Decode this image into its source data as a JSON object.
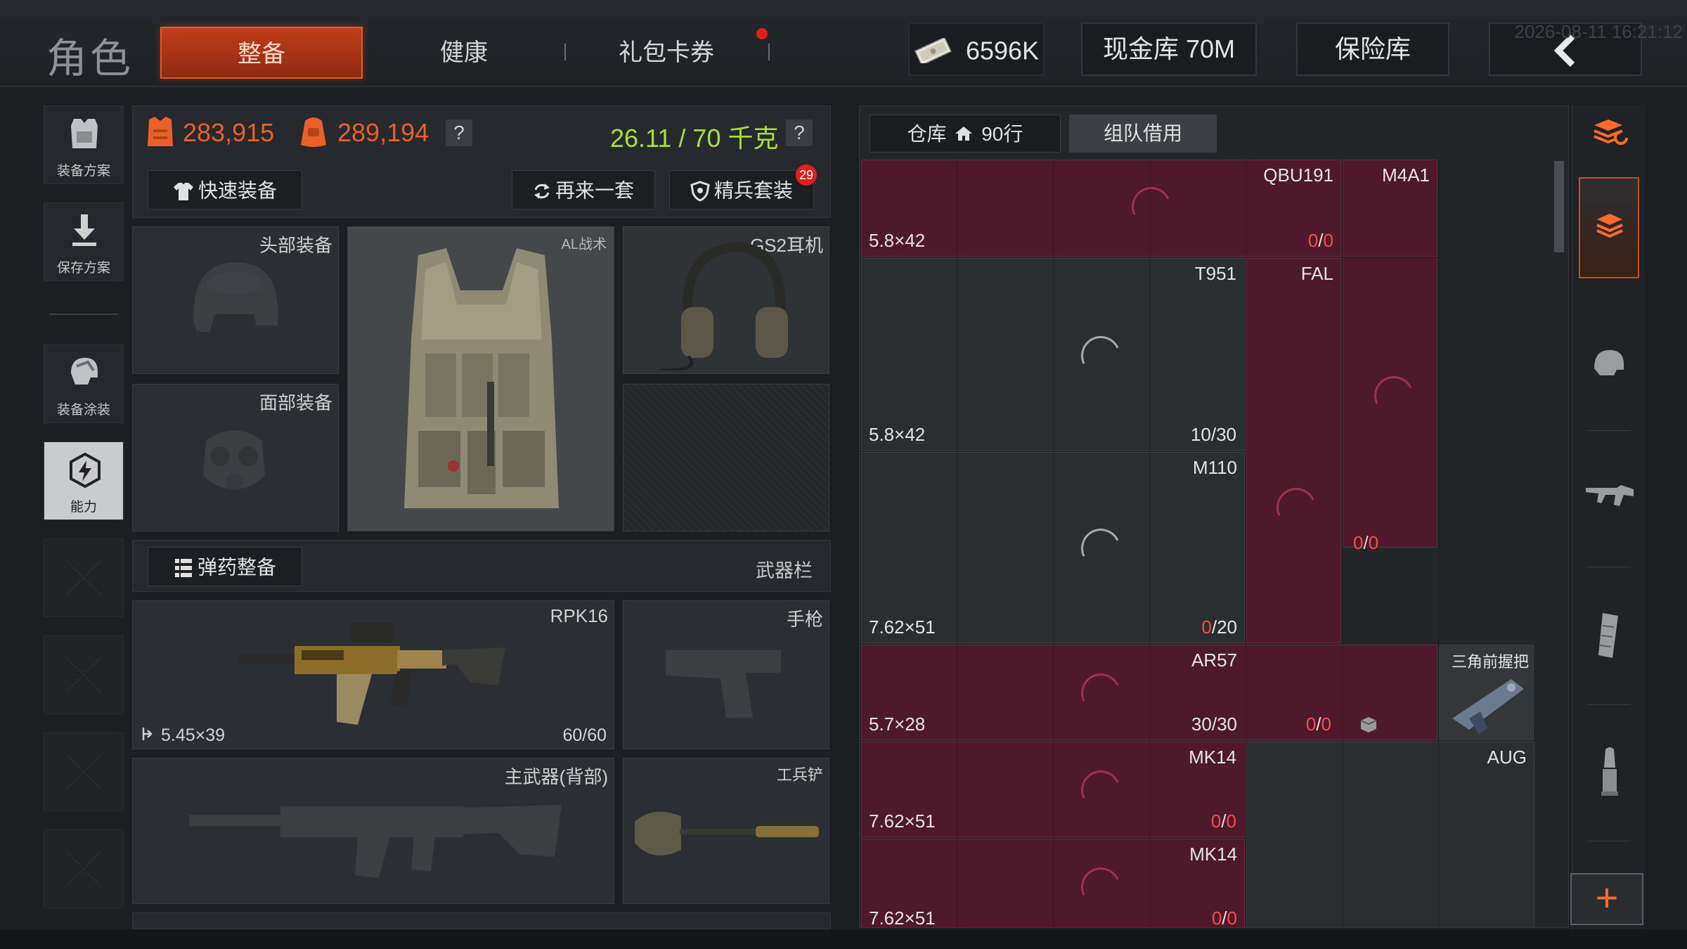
{
  "header": {
    "title": "角色",
    "tabs": [
      {
        "label": "整备",
        "active": true
      },
      {
        "label": "健康",
        "active": false
      },
      {
        "label": "礼包卡券",
        "active": false
      }
    ],
    "currency": "6596K",
    "cash_vault": "现金库 70M",
    "safe_vault": "保险库",
    "timestamp": "2026-08-11 16:21:12"
  },
  "sidebar": {
    "items": [
      {
        "label": "装备方案",
        "icon": "loadout-icon"
      },
      {
        "label": "保存方案",
        "icon": "save-icon"
      },
      {
        "label": "装备涂装",
        "icon": "paint-icon"
      },
      {
        "label": "能力",
        "icon": "ability-icon",
        "active": true
      }
    ]
  },
  "stats": {
    "armor_value": "283,915",
    "backpack_value": "289,194",
    "weight": "26.11 / 70 千克",
    "help": "?"
  },
  "actions": {
    "quick_equip": "快速装备",
    "another_set": "再来一套",
    "elite_set": "精兵套装",
    "elite_badge": "29"
  },
  "slots": {
    "head": "头部装备",
    "face": "面部装备",
    "vest_tag": "AL战术",
    "headset": "GS2耳机",
    "ammo_btn": "弹药整备",
    "weapon_bar": "武器栏",
    "primary_name": "RPK16",
    "primary_caliber": "5.45×39",
    "primary_ammo": "60/60",
    "pistol": "手枪",
    "back_weapon": "主武器(背部)",
    "melee": "工兵铲"
  },
  "warehouse": {
    "tab_storage": "仓库",
    "tab_rows": "90行",
    "tab_team": "组队借用",
    "items": [
      {
        "name": "QBU191",
        "caliber": "5.8×42",
        "count_red": "0",
        "count_cap": "0"
      },
      {
        "name": "M4A1",
        "caliber": "",
        "count_red": "",
        "count_cap": ""
      },
      {
        "name": "T951",
        "caliber": "5.8×42",
        "count_white": "10/30"
      },
      {
        "name": "FAL",
        "caliber": "",
        "count_red": "0",
        "count_cap": "0"
      },
      {
        "name": "M110",
        "caliber": "7.62×51",
        "count_red": "0",
        "count_cap": "20"
      },
      {
        "name": "AR57",
        "caliber": "5.7×28",
        "count_white": "30/30",
        "count_red2": "0",
        "count_cap2": "0"
      },
      {
        "name": "三角前握把"
      },
      {
        "name": "MK14",
        "caliber": "7.62×51",
        "count_red": "0",
        "count_cap": "0"
      },
      {
        "name": "AUG"
      },
      {
        "name": "MK14",
        "caliber": "7.62×51",
        "count_red": "0",
        "count_cap": "0"
      }
    ],
    "slash": "/"
  },
  "right_bar": {
    "plus": "+",
    "icons": [
      "stack-refresh-icon",
      "stack-icon",
      "helmet-icon",
      "rifle-icon",
      "magazine-icon",
      "bullet-icon"
    ]
  },
  "colors": {
    "accent": "#e15a2c",
    "item_red": "#4e1a2b",
    "weight_green": "#a8e03a"
  }
}
